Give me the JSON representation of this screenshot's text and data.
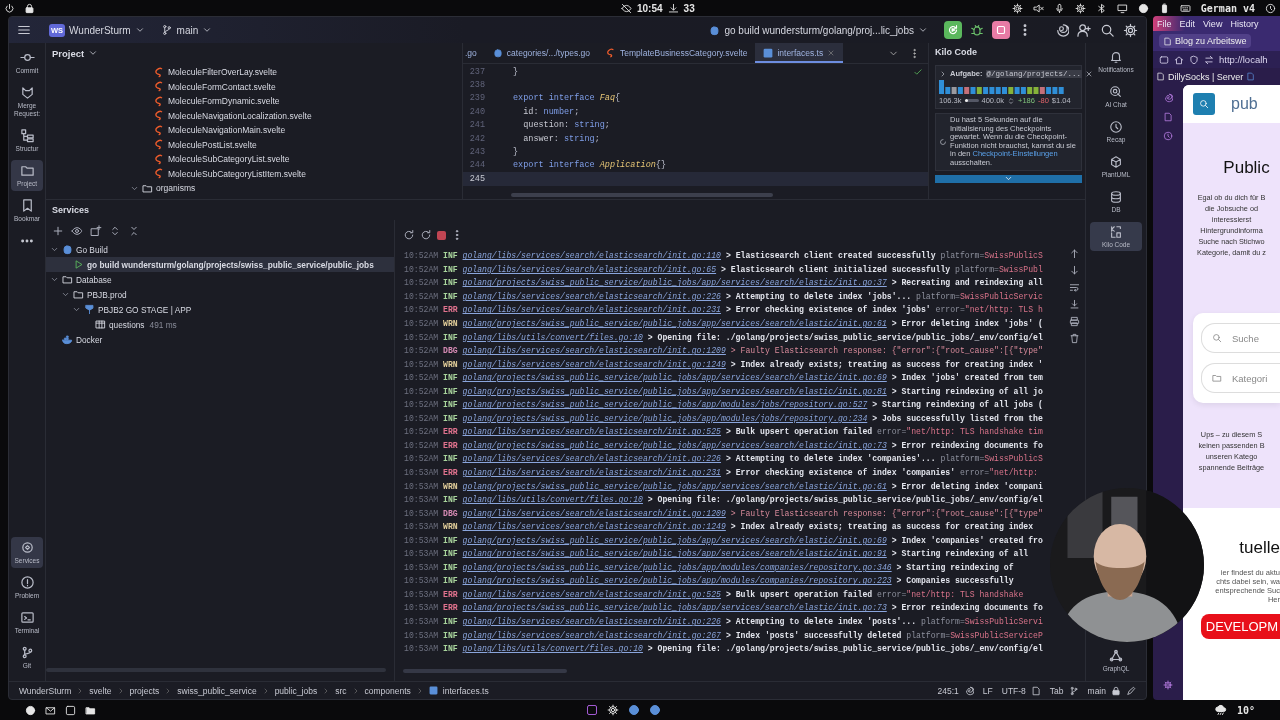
{
  "system_bar": {
    "clock": "10:54",
    "downloads": "33",
    "keyboard": "German v4"
  },
  "ide": {
    "header": {
      "project_badge": "WS",
      "project": "WunderSturm",
      "branch": "main",
      "run_config": "go build wundersturm/golang/proj...lic_jobs"
    },
    "left_toolbar": [
      {
        "label": "Commit",
        "selected": false
      },
      {
        "label": "Merge Request:",
        "selected": false
      },
      {
        "label": "Structur",
        "selected": false
      },
      {
        "label": "Project",
        "selected": true
      },
      {
        "label": "Bookmar",
        "selected": false
      }
    ],
    "left_toolbar_bottom": [
      {
        "label": "Services",
        "selected": true
      },
      {
        "label": "Problem",
        "selected": false
      },
      {
        "label": "Terminal",
        "selected": false
      },
      {
        "label": "Git",
        "selected": false
      }
    ],
    "project_panel": {
      "title": "Project",
      "items": [
        {
          "name": "MoleculeFilterOverLay.svelte",
          "kind": "file"
        },
        {
          "name": "MoleculeFormContact.svelte",
          "kind": "file"
        },
        {
          "name": "MoleculeFormDynamic.svelte",
          "kind": "file"
        },
        {
          "name": "MoleculeNavigationLocalization.svelte",
          "kind": "file"
        },
        {
          "name": "MoleculeNavigationMain.svelte",
          "kind": "file"
        },
        {
          "name": "MoleculePostList.svelte",
          "kind": "file"
        },
        {
          "name": "MoleculeSubCategoryList.svelte",
          "kind": "file"
        },
        {
          "name": "MoleculeSubCategoryListItem.svelte",
          "kind": "file"
        },
        {
          "name": "organisms",
          "kind": "folder",
          "expanded": true
        }
      ]
    },
    "editor": {
      "tabs": [
        {
          "label": ".go",
          "kind": "plain",
          "selected": false
        },
        {
          "label": "categories/.../types.go",
          "kind": "go",
          "selected": false
        },
        {
          "label": "TemplateBusinessCategory.svelte",
          "kind": "svelte",
          "selected": false
        },
        {
          "label": "interfaces.ts",
          "kind": "ts",
          "selected": true
        }
      ],
      "lines": [
        {
          "number": "237",
          "current": false,
          "tokens": [
            {
              "text": "}",
              "kind": "punct"
            }
          ]
        },
        {
          "number": "238",
          "current": false
        },
        {
          "number": "239",
          "current": false,
          "tokens": [
            {
              "text": "export interface ",
              "kind": "keyword"
            },
            {
              "text": "Faq",
              "kind": "name"
            },
            {
              "text": "{",
              "kind": "punct"
            }
          ]
        },
        {
          "number": "240",
          "current": false,
          "tokens": [
            {
              "text": "  id",
              "kind": "prop"
            },
            {
              "text": ": ",
              "kind": "punct"
            },
            {
              "text": "number",
              "kind": "keyword"
            },
            {
              "text": ";",
              "kind": "punct"
            }
          ]
        },
        {
          "number": "241",
          "current": false,
          "tokens": [
            {
              "text": "  question",
              "kind": "prop"
            },
            {
              "text": ": ",
              "kind": "punct"
            },
            {
              "text": "string",
              "kind": "keyword"
            },
            {
              "text": ";",
              "kind": "punct"
            }
          ]
        },
        {
          "number": "242",
          "current": false,
          "tokens": [
            {
              "text": "  answer",
              "kind": "prop"
            },
            {
              "text": ": ",
              "kind": "punct"
            },
            {
              "text": "string",
              "kind": "keyword"
            },
            {
              "text": ";",
              "kind": "punct"
            }
          ]
        },
        {
          "number": "243",
          "current": false,
          "tokens": [
            {
              "text": "}",
              "kind": "punct"
            }
          ]
        },
        {
          "number": "244",
          "current": false,
          "tokens": [
            {
              "text": "export interface ",
              "kind": "keyword"
            },
            {
              "text": "Application",
              "kind": "name"
            },
            {
              "text": "{}",
              "kind": "punct"
            }
          ]
        },
        {
          "number": "245",
          "current": true
        }
      ]
    },
    "kilo": {
      "title": "Kilo Code",
      "task_label": "Aufgabe:",
      "task": "@/golang/projects/...",
      "context": {
        "used": "106.3k",
        "limit": "400.0k",
        "level": 0.27
      },
      "added": "+186",
      "removed": "-80",
      "cost": "$1.04",
      "message": "Du hast 5 Sekunden auf die Initialisierung des Checkpoints gewartet. Wenn du die Checkpoint-Funktion nicht brauchst, kannst du sie in den",
      "link": "Checkpoint-Einstellungen",
      "message_end": "ausschalten."
    },
    "right_toolbar": [
      {
        "label": "Notifications",
        "selected": false
      },
      {
        "label": "AI Chat",
        "selected": false
      },
      {
        "label": "Recap",
        "selected": false
      },
      {
        "label": "PlantUML",
        "selected": false
      },
      {
        "label": "DB",
        "selected": false
      },
      {
        "label": "Kilo Code",
        "selected": true
      },
      {
        "label": "GraphQL",
        "selected": false
      }
    ],
    "services": {
      "title": "Services",
      "tree": [
        {
          "label": "Go Build",
          "kind": "gobuild",
          "expanded": true,
          "selected": false,
          "children": [
            {
              "label": "go build wundersturm/golang/projects/swiss_public_service/public_jobs",
              "kind": "run",
              "selected": true
            }
          ]
        },
        {
          "label": "Database",
          "kind": "folder",
          "expanded": true,
          "selected": false,
          "children": [
            {
              "label": "PBJB.prod",
              "kind": "folder",
              "expanded": true,
              "selected": false,
              "children": [
                {
                  "label": "PBJB2 GO STAGE | APP",
                  "kind": "datasource",
                  "expanded": true,
                  "selected": false,
                  "children": [
                    {
                      "label": "questions",
                      "detail": "491 ms",
                      "kind": "table",
                      "selected": false
                    }
                  ]
                }
              ]
            }
          ]
        },
        {
          "label": "Docker",
          "kind": "docker",
          "selected": false
        }
      ]
    },
    "logs": [
      {
        "time": "10:52AM",
        "tag": "INF",
        "kind": "info",
        "source": "golang/libs/services/search/elasticsearch/init.go:110",
        "message": "> Elasticsearch client created successfully",
        "attr": "platform=SwissPublicS"
      },
      {
        "time": "10:52AM",
        "tag": "INF",
        "kind": "info",
        "source": "golang/libs/services/search/elasticsearch/init.go:65",
        "message": "> Elasticsearch client initialized successfully",
        "attr": "platform=SwissPubl"
      },
      {
        "time": "10:52AM",
        "tag": "INF",
        "kind": "info",
        "source": "golang/projects/swiss_public_service/public_jobs/app/services/search/elastic/init.go:37",
        "message": "> Recreating and reindexing all"
      },
      {
        "time": "10:52AM",
        "tag": "INF",
        "kind": "info",
        "source": "golang/libs/services/search/elasticsearch/init.go:226",
        "message": "> Attempting to delete index 'jobs'...",
        "attr": "platform=SwissPublicServic"
      },
      {
        "time": "10:52AM",
        "tag": "ERR",
        "kind": "error",
        "source": "golang/libs/services/search/elasticsearch/init.go:231",
        "message": "> Error checking existence of index 'jobs'",
        "attr": "error=\"net/http: TLS h"
      },
      {
        "time": "10:52AM",
        "tag": "WRN",
        "kind": "warn",
        "source": "golang/projects/swiss_public_service/public_jobs/app/services/search/elastic/init.go:61",
        "message": "> Error deleting index 'jobs' ("
      },
      {
        "time": "10:52AM",
        "tag": "INF",
        "kind": "info",
        "source": "golang/libs/utils/convert/files.go:10",
        "message": "> Opening file: ./golang/projects/swiss_public_service/public_jobs/_env/config/el"
      },
      {
        "time": "10:52AM",
        "tag": "DBG",
        "kind": "debug",
        "source": "golang/libs/services/search/elasticsearch/init.go:1209",
        "message": "> Faulty Elasticsearch response: {\"error\":{\"root_cause\":[{\"type\""
      },
      {
        "time": "10:52AM",
        "tag": "WRN",
        "kind": "warn",
        "source": "golang/libs/services/search/elasticsearch/init.go:1249",
        "message": "> Index already exists; treating as success for creating index '"
      },
      {
        "time": "10:52AM",
        "tag": "INF",
        "kind": "info",
        "source": "golang/projects/swiss_public_service/public_jobs/app/services/search/elastic/init.go:69",
        "message": "> Index 'jobs' created from tem"
      },
      {
        "time": "10:52AM",
        "tag": "INF",
        "kind": "info",
        "source": "golang/projects/swiss_public_service/public_jobs/app/services/search/elastic/init.go:81",
        "message": "> Starting reindexing of all jo"
      },
      {
        "time": "10:52AM",
        "tag": "INF",
        "kind": "info",
        "source": "golang/projects/swiss_public_service/public_jobs/app/modules/jobs/repository.go:527",
        "message": "> Starting reindexing of all jobs ("
      },
      {
        "time": "10:52AM",
        "tag": "INF",
        "kind": "info",
        "source": "golang/projects/swiss_public_service/public_jobs/app/modules/jobs/repository.go:234",
        "message": "> Jobs successfully listed from the"
      },
      {
        "time": "10:52AM",
        "tag": "ERR",
        "kind": "error",
        "source": "golang/libs/services/search/elasticsearch/init.go:525",
        "message": "> Bulk upsert operation failed",
        "attr": "error=\"net/http: TLS handshake tim"
      },
      {
        "time": "10:52AM",
        "tag": "ERR",
        "kind": "error",
        "source": "golang/projects/swiss_public_service/public_jobs/app/services/search/elastic/init.go:73",
        "message": "> Error reindexing documents fo"
      },
      {
        "time": "10:52AM",
        "tag": "INF",
        "kind": "info",
        "source": "golang/libs/services/search/elasticsearch/init.go:226",
        "message": "> Attempting to delete index 'companies'...",
        "attr": "platform=SwissPublicS"
      },
      {
        "time": "10:53AM",
        "tag": "ERR",
        "kind": "error",
        "source": "golang/libs/services/search/elasticsearch/init.go:231",
        "message": "> Error checking existence of index 'companies'",
        "attr": "error=\"net/http:"
      },
      {
        "time": "10:53AM",
        "tag": "WRN",
        "kind": "warn",
        "source": "golang/projects/swiss_public_service/public_jobs/app/services/search/elastic/init.go:61",
        "message": "> Error deleting index 'compani"
      },
      {
        "time": "10:53AM",
        "tag": "INF",
        "kind": "info",
        "source": "golang/libs/utils/convert/files.go:10",
        "message": "> Opening file: ./golang/projects/swiss_public_service/public_jobs/_env/config/el"
      },
      {
        "time": "10:53AM",
        "tag": "DBG",
        "kind": "debug",
        "source": "golang/libs/services/search/elasticsearch/init.go:1209",
        "message": "> Faulty Elasticsearch response: {\"error\":{\"root_cause\":[{\"type\""
      },
      {
        "time": "10:53AM",
        "tag": "WRN",
        "kind": "warn",
        "source": "golang/libs/services/search/elasticsearch/init.go:1249",
        "message": "> Index already exists; treating as success for creating index"
      },
      {
        "time": "10:53AM",
        "tag": "INF",
        "kind": "info",
        "source": "golang/projects/swiss_public_service/public_jobs/app/services/search/elastic/init.go:69",
        "message": "> Index 'companies' created fro"
      },
      {
        "time": "10:53AM",
        "tag": "INF",
        "kind": "info",
        "source": "golang/projects/swiss_public_service/public_jobs/app/services/search/elastic/init.go:91",
        "message": "> Starting reindexing of all"
      },
      {
        "time": "10:53AM",
        "tag": "INF",
        "kind": "info",
        "source": "golang/projects/swiss_public_service/public_jobs/app/modules/companies/repository.go:346",
        "message": "> Starting reindexing of"
      },
      {
        "time": "10:53AM",
        "tag": "INF",
        "kind": "info",
        "source": "golang/projects/swiss_public_service/public_jobs/app/modules/companies/repository.go:223",
        "message": "> Companies successfully"
      },
      {
        "time": "10:53AM",
        "tag": "ERR",
        "kind": "error",
        "source": "golang/libs/services/search/elasticsearch/init.go:525",
        "message": "> Bulk upsert operation failed",
        "attr": "error=\"net/http: TLS handshake"
      },
      {
        "time": "10:53AM",
        "tag": "ERR",
        "kind": "error",
        "source": "golang/projects/swiss_public_service/public_jobs/app/services/search/elastic/init.go:73",
        "message": "> Error reindexing documents fo"
      },
      {
        "time": "10:53AM",
        "tag": "INF",
        "kind": "info",
        "source": "golang/libs/services/search/elasticsearch/init.go:226",
        "message": "> Attempting to delete index 'posts'...",
        "attr": "platform=SwissPublicServi"
      },
      {
        "time": "10:53AM",
        "tag": "INF",
        "kind": "info",
        "source": "golang/libs/services/search/elasticsearch/init.go:267",
        "message": "> Index 'posts' successfully deleted",
        "attr": "platform=SwissPublicServiceP"
      },
      {
        "time": "10:53AM",
        "tag": "INF",
        "kind": "info",
        "source": "golang/libs/utils/convert/files.go:10",
        "message": "> Opening file: ./golang/projects/swiss_public_service/public_jobs/_env/config/el"
      }
    ],
    "status_bar": {
      "breadcrumbs": [
        "WunderSturm",
        "svelte",
        "projects",
        "swiss_public_service",
        "public_jobs",
        "src",
        "components",
        "interfaces.ts"
      ],
      "position": "245:1",
      "line_ending": "LF",
      "encoding": "UTF-8",
      "indent": "Tab",
      "branch": "main"
    }
  },
  "browser": {
    "menu": [
      "File",
      "Edit",
      "View",
      "History"
    ],
    "tab": "Blog zu Arbeitswe",
    "url": "http://localh",
    "bookmark": "DillySocks | Server",
    "page": {
      "header": "pub",
      "hero": "Public",
      "intro": [
        "Egal ob du dich für B",
        "die Jobsuche od",
        "interessierst",
        "Hintergrundinforma",
        "Suche nach Stichwo",
        "Kategorie, damit du z"
      ],
      "search_placeholder": "Suche",
      "category_placeholder": "Kategori",
      "empty": [
        "Ups – zu diesem S",
        "keinen passenden B",
        "unseren Katego",
        "spannende Beiträge"
      ],
      "section_title": "tuelle",
      "section_text": [
        "ier findest du aktu",
        "chts dabei sein, wa",
        "entsprechende Suc",
        "Her"
      ],
      "button": "DEVELOPM"
    }
  },
  "taskbar": {
    "weather": "10°"
  }
}
